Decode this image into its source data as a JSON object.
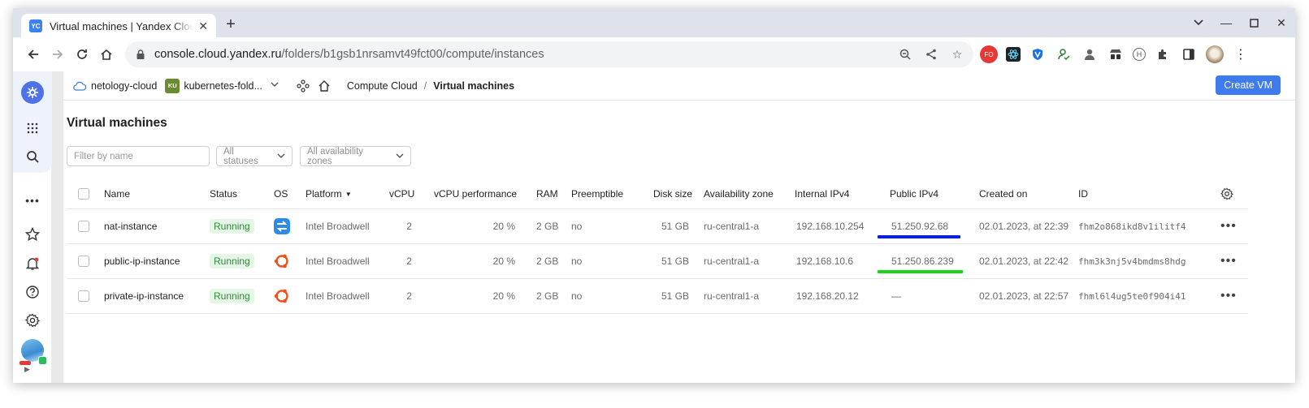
{
  "browser": {
    "tab_title": "Virtual machines | Yandex Cloud",
    "favicon_text": "YC",
    "url_host": "console.cloud.yandex.ru",
    "url_path": "/folders/b1gsb1nrsamvt49fct00/compute/instances",
    "ext_fo_text": "FO"
  },
  "header": {
    "cloud_name": "netology-cloud",
    "folder_chip": "KU",
    "folder_name": "kubernetes-fold...",
    "breadcrumb_service": "Compute Cloud",
    "breadcrumb_separator": "/",
    "breadcrumb_current": "Virtual machines",
    "create_button": "Create VM"
  },
  "page": {
    "title": "Virtual machines",
    "filter_placeholder": "Filter by name",
    "status_filter": "All statuses",
    "zone_filter": "All availability zones"
  },
  "table": {
    "columns": {
      "name": "Name",
      "status": "Status",
      "os": "OS",
      "platform": "Platform",
      "vcpu": "vCPU",
      "vcpu_perf": "vCPU performance",
      "ram": "RAM",
      "preemptible": "Preemptible",
      "disk": "Disk size",
      "zone": "Availability zone",
      "internal_ip": "Internal IPv4",
      "public_ip": "Public IPv4",
      "created": "Created on",
      "id": "ID"
    },
    "rows": [
      {
        "name": "nat-instance",
        "status": "Running",
        "os": "nat",
        "platform": "Intel Broadwell",
        "vcpu": "2",
        "vcpu_perf": "20 %",
        "ram": "2 GB",
        "preemptible": "no",
        "disk": "51 GB",
        "zone": "ru-central1-a",
        "internal_ip": "192.168.10.254",
        "public_ip": "51.250.92.68",
        "created": "02.01.2023, at 22:39",
        "id": "fhm2o868ikd8v1ilitf4",
        "underline_color": "#0a1fd6"
      },
      {
        "name": "public-ip-instance",
        "status": "Running",
        "os": "ubuntu",
        "platform": "Intel Broadwell",
        "vcpu": "2",
        "vcpu_perf": "20 %",
        "ram": "2 GB",
        "preemptible": "no",
        "disk": "51 GB",
        "zone": "ru-central1-a",
        "internal_ip": "192.168.10.6",
        "public_ip": "51.250.86.239",
        "created": "02.01.2023, at 22:42",
        "id": "fhm3k3nj5v4bmdms8hdg",
        "underline_color": "#19d419"
      },
      {
        "name": "private-ip-instance",
        "status": "Running",
        "os": "ubuntu",
        "platform": "Intel Broadwell",
        "vcpu": "2",
        "vcpu_perf": "20 %",
        "ram": "2 GB",
        "preemptible": "no",
        "disk": "51 GB",
        "zone": "ru-central1-a",
        "internal_ip": "192.168.20.12",
        "public_ip": "—",
        "created": "02.01.2023, at 22:57",
        "id": "fhml6l4ug5te0f904i41",
        "underline_color": ""
      }
    ]
  },
  "colors": {
    "accent": "#3e7bef",
    "running_bg": "#e6f6e6",
    "running_text": "#2e8c3a",
    "ubuntu": "#e95420",
    "nat": "#2b8be6"
  }
}
